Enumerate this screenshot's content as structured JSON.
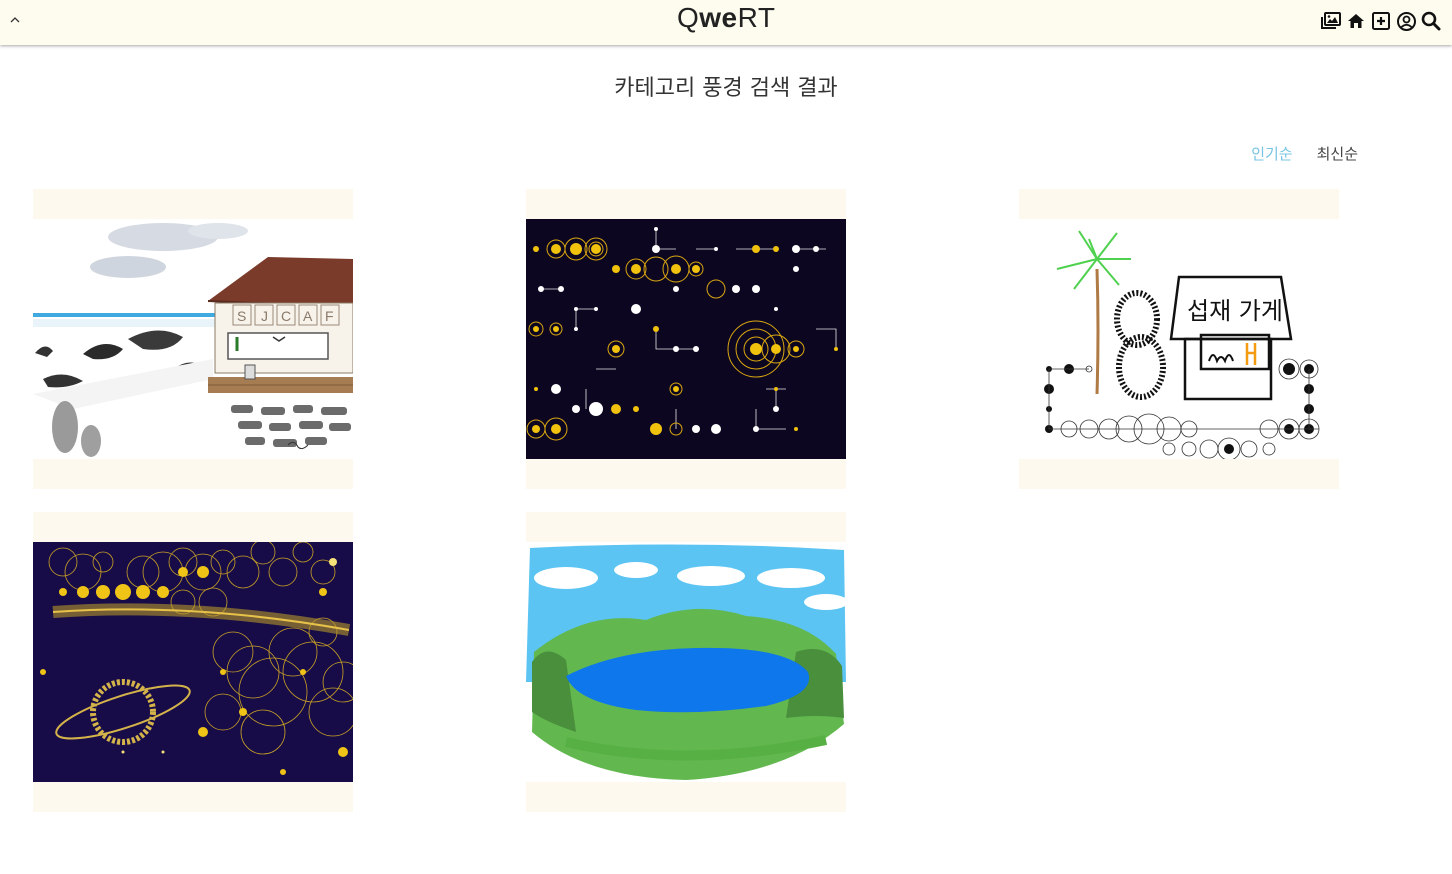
{
  "header": {
    "logo_parts": [
      "Q",
      "we",
      "RT"
    ],
    "icons": [
      "gallery-icon",
      "home-icon",
      "add-icon",
      "profile-icon",
      "search-icon"
    ],
    "background": "#fefcee"
  },
  "page": {
    "title": "카테고리 풍경 검색 결과"
  },
  "sort": {
    "popular_label": "인기순",
    "latest_label": "최신순",
    "active": "popular",
    "active_color": "#77c4e3"
  },
  "gallery": {
    "items": [
      {
        "id": "artwork-cafe",
        "caption": "SJCAFE",
        "bg": "#ffffff"
      },
      {
        "id": "artwork-constellation",
        "bg": "#0d0620"
      },
      {
        "id": "artwork-shop",
        "caption": "섭재 가게",
        "bg": "#ffffff"
      },
      {
        "id": "artwork-galaxy",
        "bg": "#170c47"
      },
      {
        "id": "artwork-crater-lake",
        "bg": "#ffffff"
      }
    ],
    "card_color": "#fdf9ef"
  }
}
